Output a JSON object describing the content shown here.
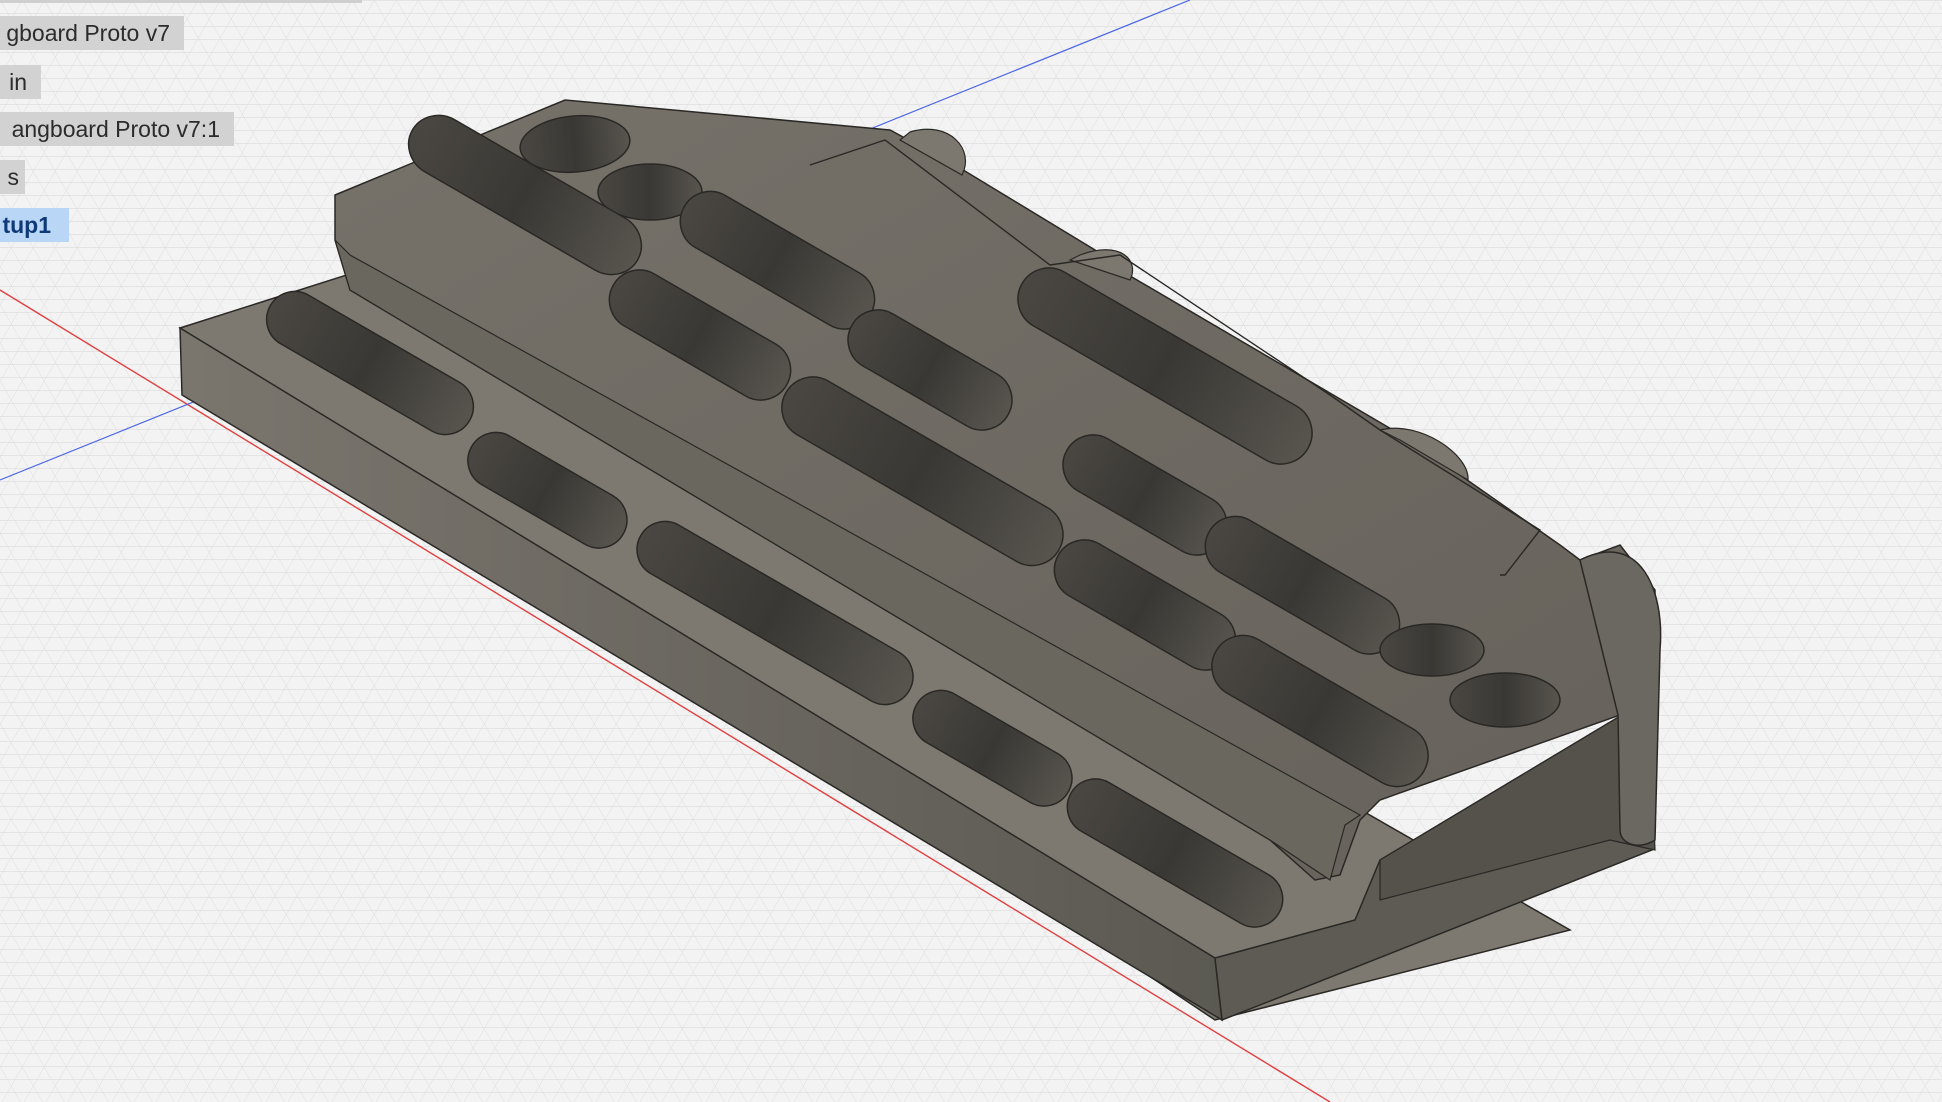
{
  "browser": {
    "nodes": [
      {
        "label": "gboard Proto v7",
        "active": false
      },
      {
        "label": "in",
        "active": false
      },
      {
        "label": "angboard Proto v7:1",
        "active": false
      },
      {
        "label": "s",
        "active": false
      },
      {
        "label": "tup1",
        "active": true
      }
    ]
  },
  "colors": {
    "grid_background": "#f3f3f3",
    "grid_minor": "#dedede",
    "grid_major": "#c9c9c9",
    "x_axis": "#e04040",
    "y_axis": "#4060e0",
    "model_body": "#6e6a62",
    "model_highlight": "#8a867d",
    "model_shadow": "#45423d",
    "active_node_bg": "#b9d6f6",
    "active_node_text": "#0f3a78"
  },
  "model": {
    "name": "hangboard",
    "icon": "3d-model"
  }
}
